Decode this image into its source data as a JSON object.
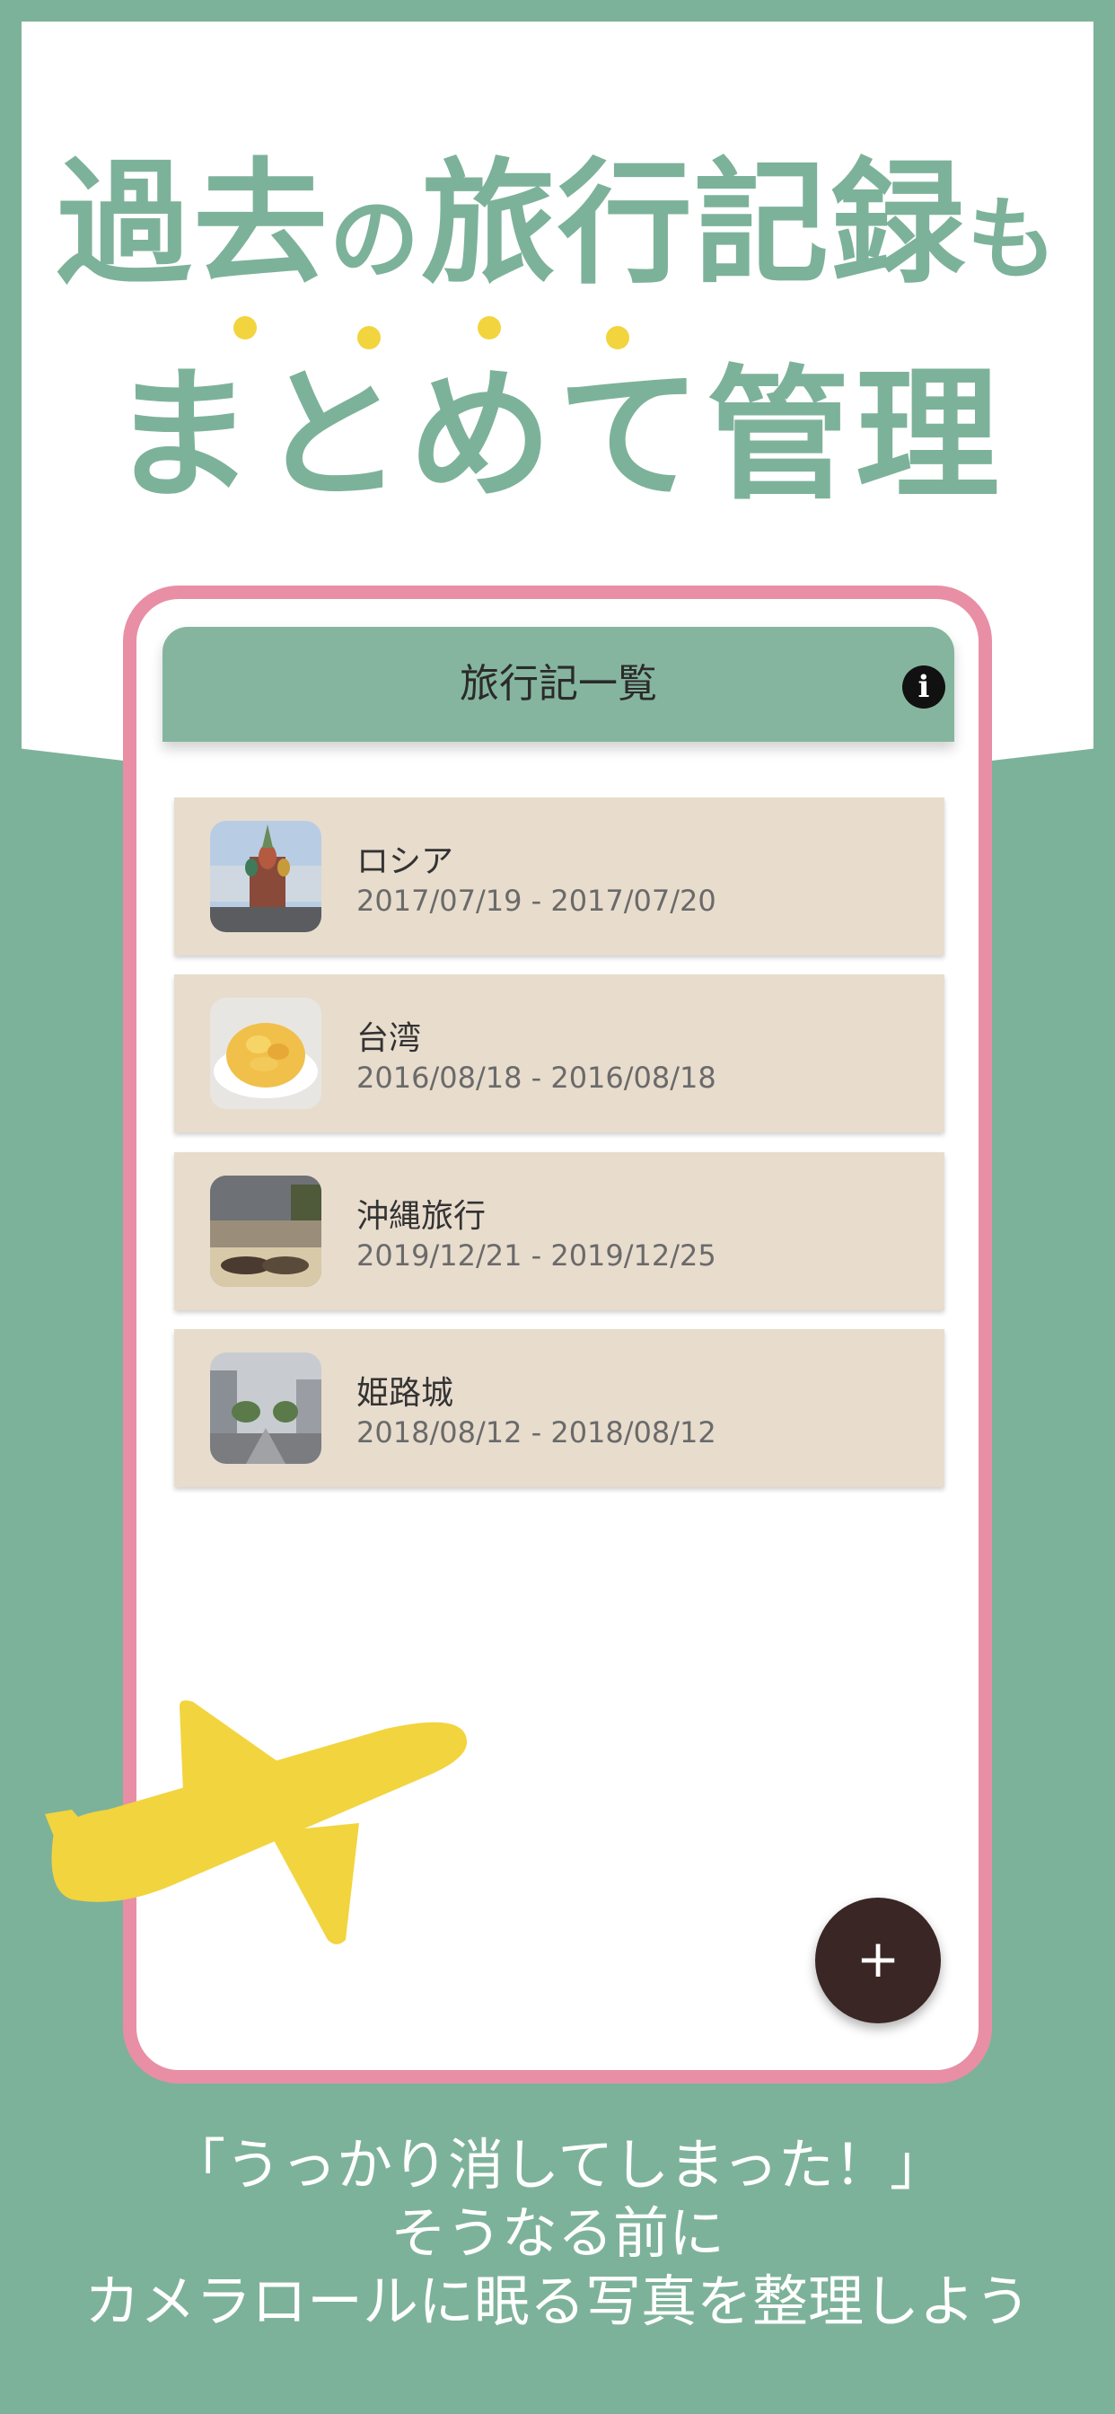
{
  "headline": {
    "line1": [
      "過去",
      "の",
      "旅行記録",
      "も"
    ],
    "line2": "まとめて管理"
  },
  "app": {
    "title": "旅行記一覧",
    "info_icon": "i",
    "fab_icon": "+",
    "trips": [
      {
        "name": "ロシア",
        "dates": "2017/07/19 - 2017/07/20"
      },
      {
        "name": "台湾",
        "dates": "2016/08/18 - 2016/08/18"
      },
      {
        "name": "沖縄旅行",
        "dates": "2019/12/21 - 2019/12/25"
      },
      {
        "name": "姫路城",
        "dates": "2018/08/12 - 2018/08/12"
      }
    ]
  },
  "footer": {
    "line1": "「うっかり消してしまった！」",
    "line2": "そうなる前に",
    "line3": "カメラロールに眠る写真を整理しよう"
  },
  "colors": {
    "background": "#7db29a",
    "accent_yellow": "#f2d43e",
    "phone_border": "#e88fa5",
    "app_bar": "#86b59f",
    "card": "#e8dccd",
    "fab": "#3a2624"
  },
  "icons": [
    "info-icon",
    "plus-icon",
    "airplane-icon"
  ]
}
